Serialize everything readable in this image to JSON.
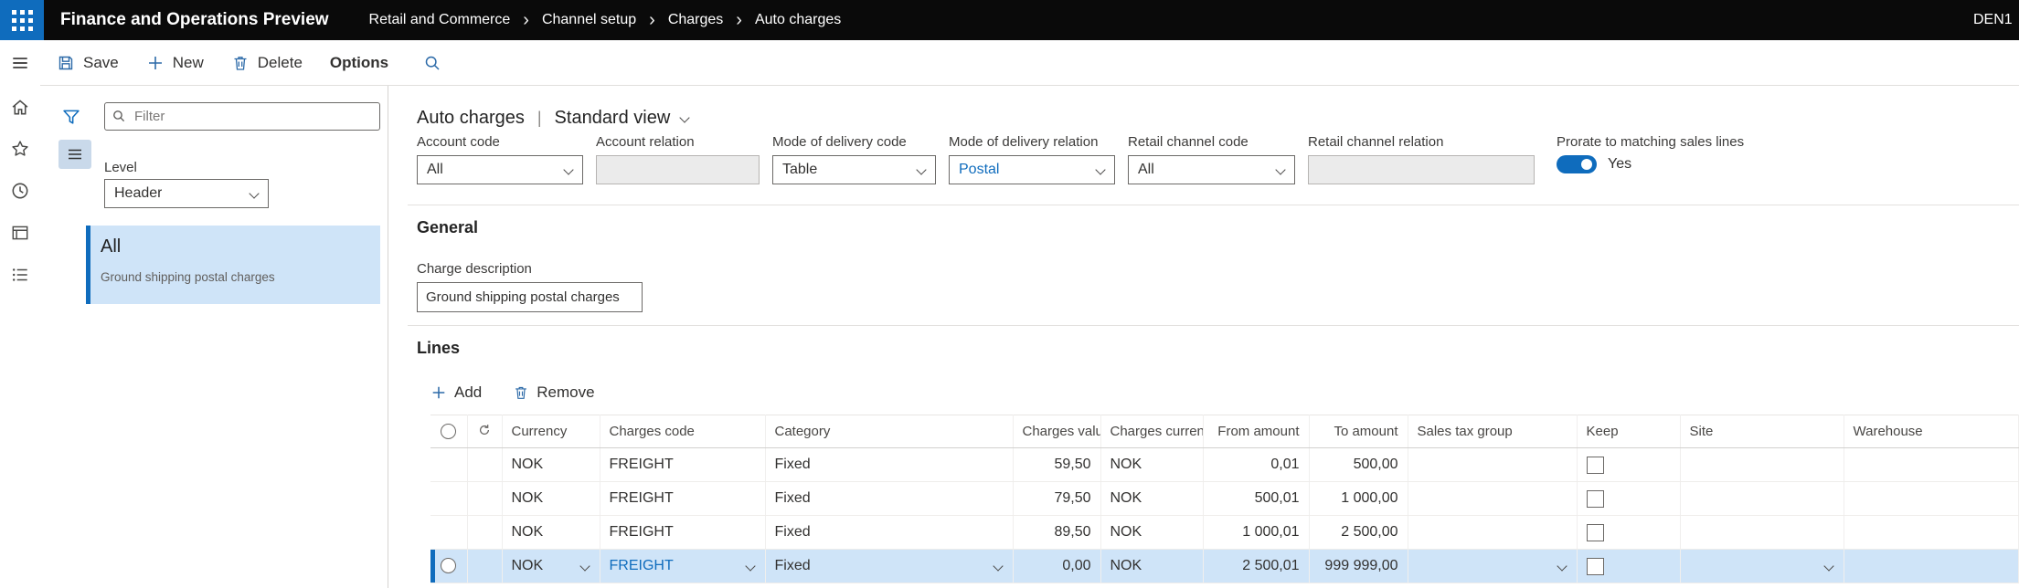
{
  "colors": {
    "accent": "#0f6cbd",
    "selection_bg": "#cfe4f8",
    "topbar_bg": "#0a0a0a"
  },
  "topbar": {
    "app_title": "Finance and Operations Preview",
    "breadcrumb": [
      "Retail and Commerce",
      "Channel setup",
      "Charges",
      "Auto charges"
    ],
    "environment": "DEN1"
  },
  "command_bar": {
    "save": "Save",
    "new": "New",
    "delete": "Delete",
    "options": "Options"
  },
  "nav_panel": {
    "filter_placeholder": "Filter",
    "level_label": "Level",
    "level_value": "Header",
    "items": [
      {
        "title": "All",
        "subtitle": "Ground shipping postal charges"
      }
    ]
  },
  "page": {
    "title": "Auto charges",
    "view_name": "Standard view"
  },
  "header_fields": [
    {
      "label": "Account code",
      "value": "All"
    },
    {
      "label": "Account relation",
      "value": ""
    },
    {
      "label": "Mode of delivery code",
      "value": "Table"
    },
    {
      "label": "Mode of delivery relation",
      "value": "Postal"
    },
    {
      "label": "Retail channel code",
      "value": "All"
    },
    {
      "label": "Retail channel relation",
      "value": ""
    }
  ],
  "prorate_toggle": {
    "label": "Prorate to matching sales lines",
    "state": "Yes"
  },
  "general": {
    "section_title": "General",
    "charge_description_label": "Charge description",
    "charge_description_value": "Ground shipping postal charges"
  },
  "lines": {
    "section_title": "Lines",
    "add_label": "Add",
    "remove_label": "Remove",
    "columns": {
      "currency": "Currency",
      "charges_code": "Charges code",
      "category": "Category",
      "charges_value": "Charges value",
      "charges_currency": "Charges curren...",
      "from_amount": "From amount",
      "to_amount": "To amount",
      "sales_tax_group": "Sales tax group",
      "keep": "Keep",
      "site": "Site",
      "warehouse": "Warehouse"
    },
    "rows": [
      {
        "currency": "NOK",
        "charges_code": "FREIGHT",
        "category": "Fixed",
        "charges_value": "59,50",
        "charges_currency": "NOK",
        "from_amount": "0,01",
        "to_amount": "500,00",
        "sales_tax_group": "",
        "keep": false,
        "site": "",
        "warehouse": "",
        "selected": false
      },
      {
        "currency": "NOK",
        "charges_code": "FREIGHT",
        "category": "Fixed",
        "charges_value": "79,50",
        "charges_currency": "NOK",
        "from_amount": "500,01",
        "to_amount": "1 000,00",
        "sales_tax_group": "",
        "keep": false,
        "site": "",
        "warehouse": "",
        "selected": false
      },
      {
        "currency": "NOK",
        "charges_code": "FREIGHT",
        "category": "Fixed",
        "charges_value": "89,50",
        "charges_currency": "NOK",
        "from_amount": "1 000,01",
        "to_amount": "2 500,00",
        "sales_tax_group": "",
        "keep": false,
        "site": "",
        "warehouse": "",
        "selected": false
      },
      {
        "currency": "NOK",
        "charges_code": "FREIGHT",
        "category": "Fixed",
        "charges_value": "0,00",
        "charges_currency": "NOK",
        "from_amount": "2 500,01",
        "to_amount": "999 999,00",
        "sales_tax_group": "",
        "keep": false,
        "site": "",
        "warehouse": "",
        "selected": true
      }
    ]
  }
}
